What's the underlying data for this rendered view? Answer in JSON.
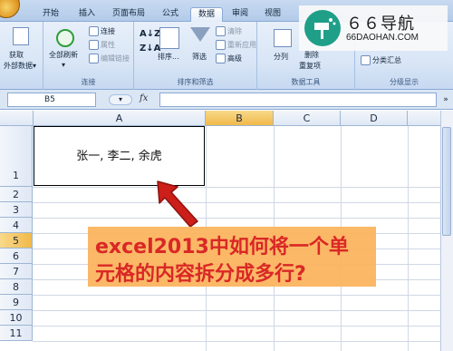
{
  "ribbon_tabs": [
    {
      "label": "开始",
      "active": false
    },
    {
      "label": "插入",
      "active": false
    },
    {
      "label": "页面布局",
      "active": false
    },
    {
      "label": "公式",
      "active": false
    },
    {
      "label": "数据",
      "active": true
    },
    {
      "label": "审阅",
      "active": false
    },
    {
      "label": "视图",
      "active": false
    }
  ],
  "groups": {
    "external": {
      "btn1": "获取",
      "btn2": "外部数据▾"
    },
    "connections": {
      "label": "连接",
      "refresh1": "全部刷新",
      "refresh2": "▾",
      "items": [
        "连接",
        "属性",
        "编辑链接"
      ]
    },
    "sort_filter": {
      "label": "排序和筛选",
      "sort": "排序...",
      "filter": "筛选",
      "items": [
        "清除",
        "重新应用",
        "高级"
      ]
    },
    "data_tools": {
      "label": "数据工具",
      "split": "分列",
      "dup": "删除",
      "dup2": "重复项"
    },
    "outline": {
      "label": "分级显示",
      "subtotal": "分类汇总"
    }
  },
  "watermark": {
    "title": "６６导航",
    "url": "66DAOHAN.COM"
  },
  "formula_bar": {
    "name_box": "B5",
    "fx": "fx",
    "formula": ""
  },
  "columns": [
    "A",
    "B",
    "C",
    "D"
  ],
  "selected_column": "B",
  "rows": [
    "1",
    "2",
    "3",
    "4",
    "5",
    "6",
    "7",
    "8",
    "9",
    "10",
    "11"
  ],
  "selected_row": "5",
  "cells": {
    "A1": "张一, 李二, 余虎"
  },
  "callout": {
    "line1": "excel2013中如何将一个单",
    "line2": "元格的内容拆分成多行?"
  },
  "colors": {
    "callout_bg": "#fbb661",
    "callout_text": "#d9201e",
    "arrow": "#cc1f1a",
    "selected_header": "#f1b94a"
  }
}
